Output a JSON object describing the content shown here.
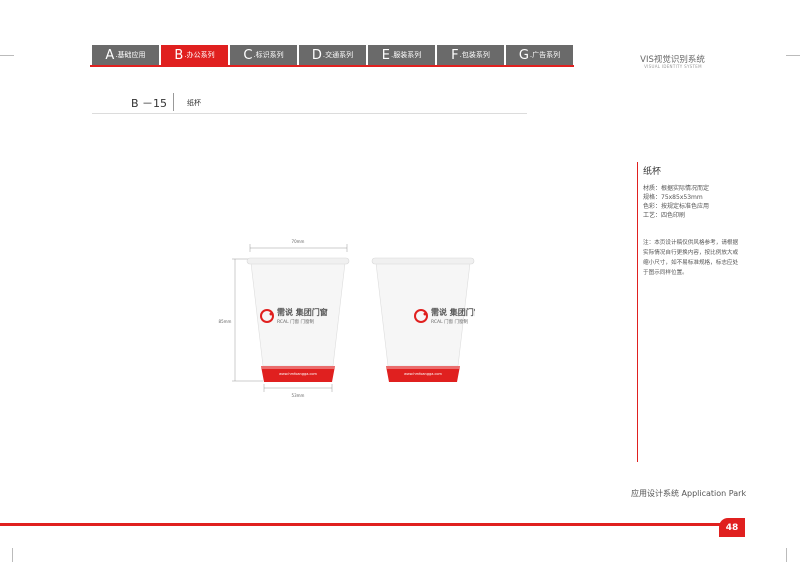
{
  "header": {
    "tabs": [
      {
        "letter": "A",
        "label": ".基础应用"
      },
      {
        "letter": "B",
        "label": ".办公系列"
      },
      {
        "letter": "C",
        "label": ".标识系列"
      },
      {
        "letter": "D",
        "label": ".交通系列"
      },
      {
        "letter": "E",
        "label": ".服装系列"
      },
      {
        "letter": "F",
        "label": ".包装系列"
      },
      {
        "letter": "G",
        "label": ".广告系列"
      }
    ],
    "active_tab": "B",
    "brand_title": "VIS视觉识别系统",
    "brand_subtitle": "VISUAL IDENTITY SYSTEM"
  },
  "page": {
    "code": "B －15",
    "title": "纸杯"
  },
  "figure": {
    "dim_top": "70mm",
    "dim_side": "85mm",
    "dim_bottom": "53mm",
    "logo_cn": "需说 集团门窗",
    "logo_en": "RCAL 门窗 门窗制",
    "website": "www.hmfoangga.com"
  },
  "spec": {
    "title": "纸杯",
    "material": "材质：根据实际情况而定",
    "size": "规格：75x85x53mm",
    "color": "色彩：按规定标准色应用",
    "process": "工艺：四色印刷",
    "note": "注：本页设计稿仅供风格参考，请根据实际情况自行更换内容，按比例放大或缩小尺寸，如不易标准规格，标志应处于图示同样位置。"
  },
  "footer": {
    "section": "应用设计系统  Application Park",
    "page_number": "48"
  },
  "colors": {
    "brand_red": "#e0201f",
    "tab_gray": "#6a6a6a"
  }
}
